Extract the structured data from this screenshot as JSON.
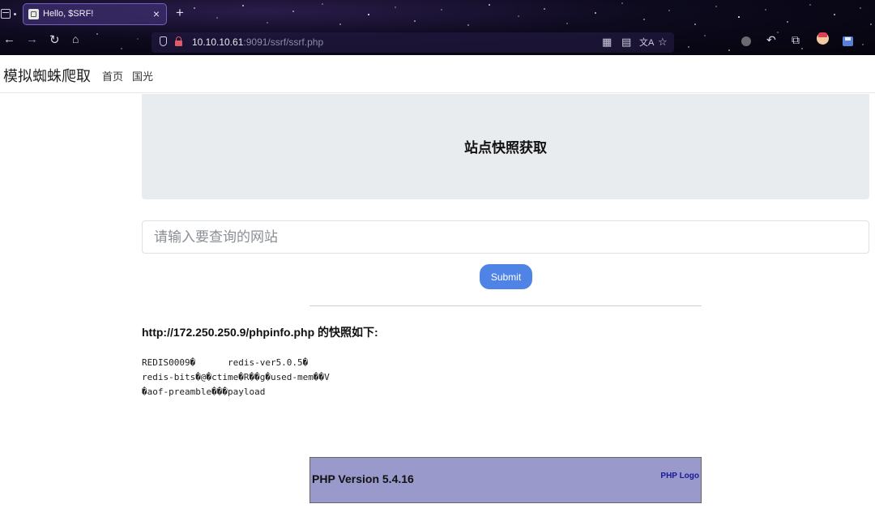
{
  "browser": {
    "tab_title": "Hello, $SRF!",
    "tab_close": "×",
    "new_tab": "+",
    "url_host": "10.10.10.61",
    "url_rest": ":9091/ssrf/ssrf.php"
  },
  "site": {
    "brand": "模拟蜘蛛爬取",
    "nav": [
      "首页",
      "国光"
    ]
  },
  "form": {
    "heading": "站点快照获取",
    "placeholder": "请输入要查询的网站",
    "value": "",
    "submit_label": "Submit"
  },
  "snapshot": {
    "title": "http://172.250.250.9/phpinfo.php 的快照如下:",
    "lines": [
      "REDIS0009�      redis-ver5.0.5�",
      "redis-bits�@�ctime�R��g�used-mem��V",
      "�aof-preamble���payload"
    ]
  },
  "phpinfo": {
    "version": "PHP Version 5.4.16",
    "logo_alt": "PHP Logo"
  }
}
